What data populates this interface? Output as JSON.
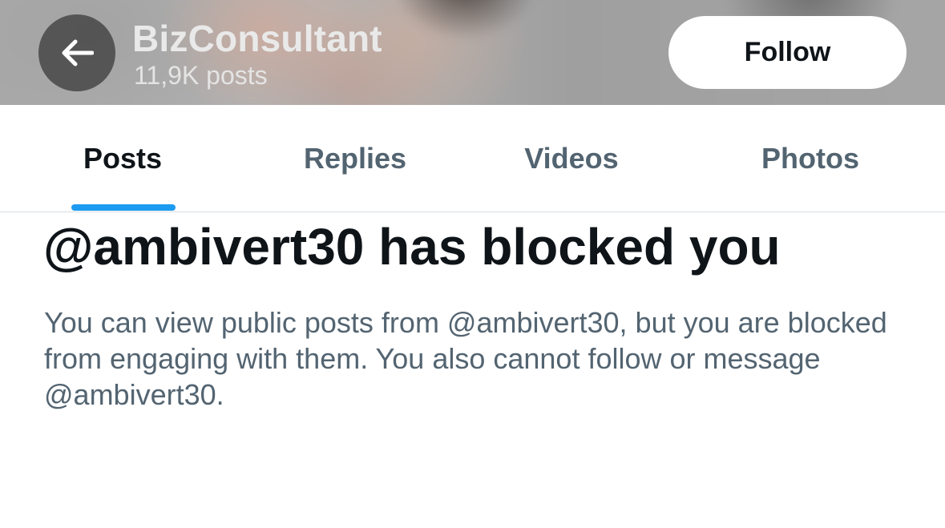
{
  "header": {
    "back_icon": "arrow-left-icon",
    "profile_name": "BizConsultant",
    "post_count": "11,9K posts",
    "follow_label": "Follow"
  },
  "tabs": [
    {
      "label": "Posts",
      "active": true
    },
    {
      "label": "Replies",
      "active": false
    },
    {
      "label": "Videos",
      "active": false
    },
    {
      "label": "Photos",
      "active": false
    }
  ],
  "blocked": {
    "title": "@ambivert30 has blocked you",
    "description": "You can view public posts from @ambivert30, but you are blocked from engaging with them. You also cannot follow or message @ambivert30."
  },
  "colors": {
    "accent": "#1d9bf0",
    "primary_text": "#0f1419",
    "secondary_text": "#536471"
  }
}
